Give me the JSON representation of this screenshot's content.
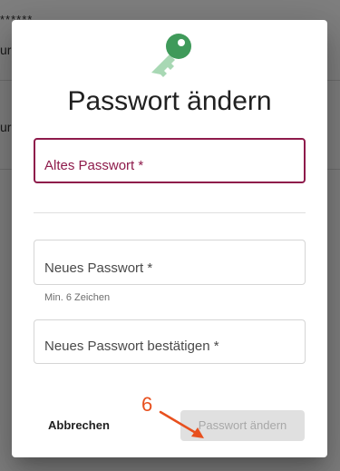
{
  "background": {
    "fragment_top": "******",
    "fragment_left_1": "ur",
    "fragment_left_2": "ur"
  },
  "dialog": {
    "icon": "key-icon",
    "title": "Passwort ändern",
    "fields": {
      "old_password": {
        "label": "Altes Passwort *"
      },
      "new_password": {
        "label": "Neues Passwort *",
        "hint": "Min. 6 Zeichen"
      },
      "confirm_password": {
        "label": "Neues Passwort bestätigen *"
      }
    },
    "buttons": {
      "cancel": "Abbrechen",
      "submit": "Passwort ändern"
    }
  },
  "annotation": {
    "number": "6"
  },
  "colors": {
    "accent": "#8e1b4b",
    "key_green": "#3f9a5a",
    "annotation": "#e8501e",
    "disabled_button": "#e0e0e0"
  }
}
